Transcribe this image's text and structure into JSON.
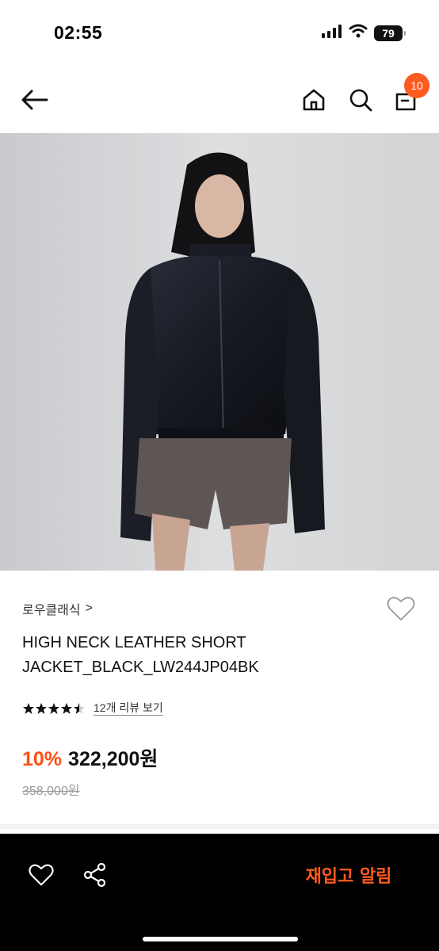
{
  "status_bar": {
    "time": "02:55",
    "battery": "79"
  },
  "header": {
    "cart_count": "10"
  },
  "product": {
    "brand": "로우클래식",
    "brand_chevron": ">",
    "name": "HIGH NECK LEATHER SHORT JACKET_BLACK_LW244JP04BK",
    "rating": 4.5,
    "review_link": "12개 리뷰 보기",
    "discount": "10%",
    "price": "322,200원",
    "original_price": "358,000원"
  },
  "bottom_bar": {
    "restock_label": "재입고 알림"
  },
  "colors": {
    "accent": "#ff5a1f",
    "bottom_bar_bg": "#000000"
  }
}
